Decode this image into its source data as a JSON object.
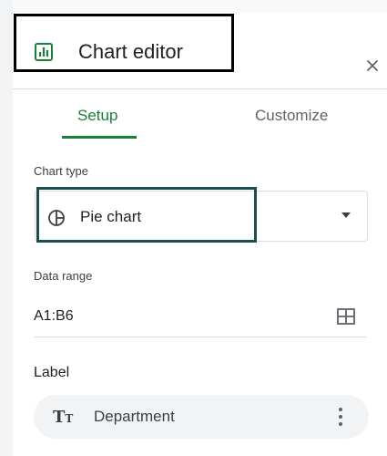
{
  "header": {
    "title": "Chart editor",
    "title_icon": "bar-chart-icon",
    "close_icon": "close-icon",
    "close_glyph": "×"
  },
  "tabs": [
    {
      "label": "Setup",
      "active": true
    },
    {
      "label": "Customize",
      "active": false
    }
  ],
  "chart_type": {
    "label": "Chart type",
    "value": "Pie chart",
    "icon": "pie-chart-icon"
  },
  "data_range": {
    "label": "Data range",
    "value": "A1:B6",
    "icon": "grid-icon"
  },
  "label_section": {
    "label": "Label",
    "chip_value": "Department",
    "chip_icon": "text-format-icon",
    "menu_icon": "more-vert-icon"
  },
  "colors": {
    "accent_green": "#188038",
    "highlight_border": "#1c4e50",
    "chip_bg": "#f1f3f4"
  }
}
